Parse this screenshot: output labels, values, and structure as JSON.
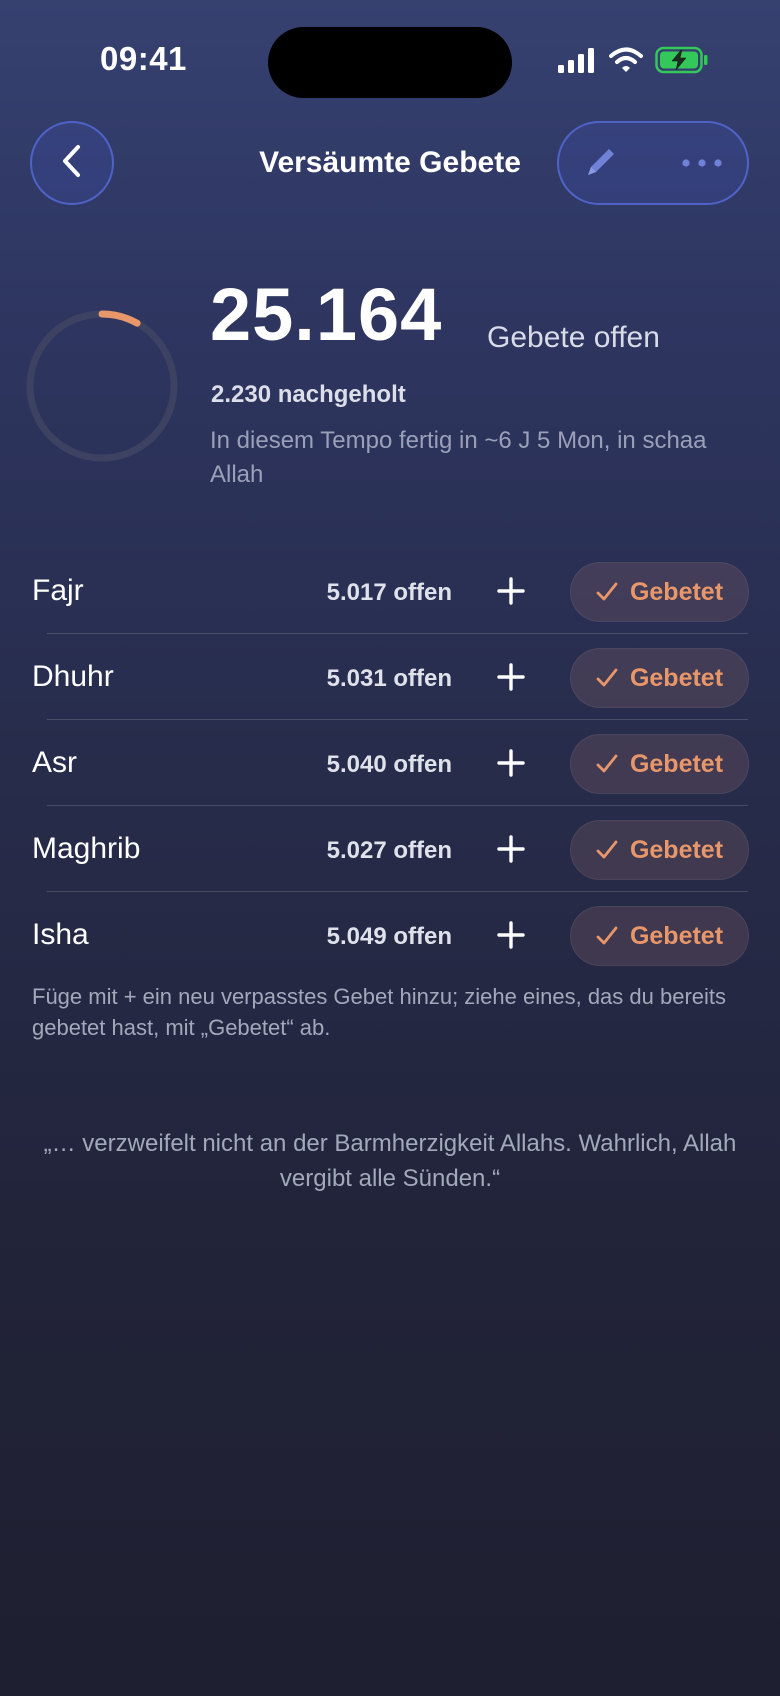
{
  "status_bar": {
    "time": "09:41"
  },
  "nav": {
    "title": "Versäumte Gebete",
    "back_icon": "chevron-left-icon",
    "edit_icon": "pencil-icon",
    "more_icon": "ellipsis-icon"
  },
  "summary": {
    "open_count": "25.164",
    "open_suffix": "Gebete offen",
    "made_up": "2.230 nachgeholt",
    "pace_text": "In diesem Tempo fertig in ~6 J 5 Mon, in schaa Allah",
    "progress_fraction": 0.081
  },
  "prayers": [
    {
      "name": "Fajr",
      "open": "5.017 offen",
      "button": "Gebetet"
    },
    {
      "name": "Dhuhr",
      "open": "5.031 offen",
      "button": "Gebetet"
    },
    {
      "name": "Asr",
      "open": "5.040 offen",
      "button": "Gebetet"
    },
    {
      "name": "Maghrib",
      "open": "5.027 offen",
      "button": "Gebetet"
    },
    {
      "name": "Isha",
      "open": "5.049 offen",
      "button": "Gebetet"
    }
  ],
  "hint": "Füge mit + ein neu verpasstes Gebet hinzu; ziehe eines, das du bereits gebetet hast, mit „Gebetet“ ab.",
  "quote": "„… verzweifelt nicht an der Barmherzigkeit Allahs. Wahrlich, Allah vergibt alle Sünden.“",
  "colors": {
    "accent": "#e8976a",
    "nav_border": "#4f63c7",
    "battery_green": "#34c759"
  }
}
